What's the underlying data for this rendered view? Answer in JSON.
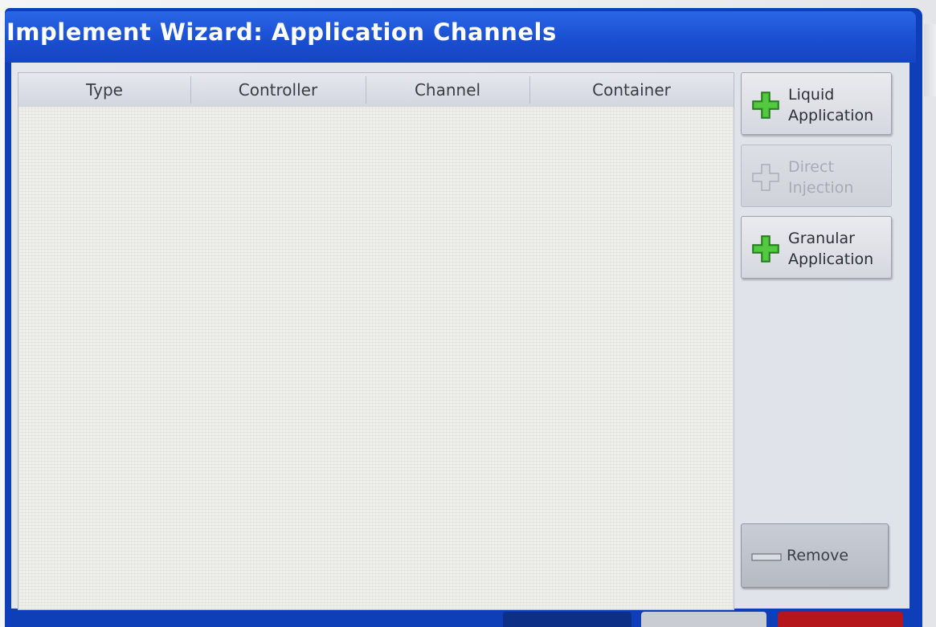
{
  "window": {
    "title": "Implement Wizard:  Application Channels"
  },
  "table": {
    "columns": [
      "Type",
      "Controller",
      "Channel",
      "Container"
    ],
    "rows": []
  },
  "actions": {
    "liquid": {
      "line1": "Liquid",
      "line2": "Application",
      "icon": "plus-icon",
      "enabled": true
    },
    "direct": {
      "line1": "Direct",
      "line2": "Injection",
      "icon": "plus-icon",
      "enabled": false
    },
    "granular": {
      "line1": "Granular",
      "line2": "Application",
      "icon": "plus-icon",
      "enabled": true
    },
    "remove": {
      "label": "Remove",
      "icon": "minus-icon"
    }
  },
  "colors": {
    "title_bar": "#1a4fd1",
    "frame": "#0f3fb8",
    "plus_green": "#3cb82c",
    "plus_disabled": "#b8bcc4",
    "back_button": "#0d2f86",
    "next_button": "#c9ccd3",
    "cancel_button": "#b5161b"
  }
}
